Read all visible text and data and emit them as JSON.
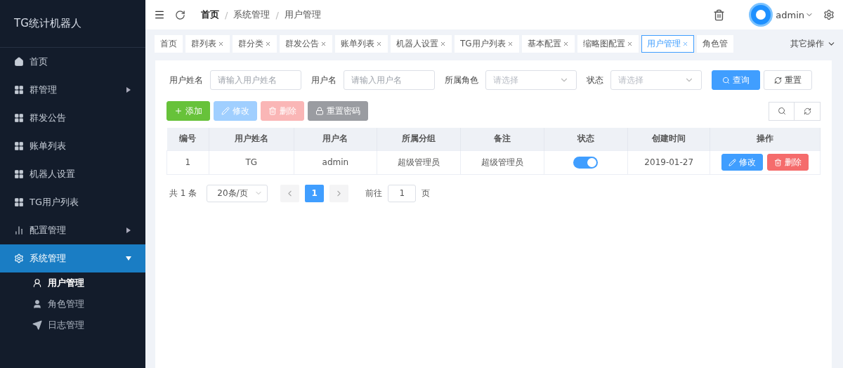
{
  "sidebar": {
    "title": "TG统计机器人",
    "items": [
      {
        "label": "首页",
        "selected": false
      },
      {
        "label": "群管理",
        "selected": false,
        "expanded": false
      },
      {
        "label": "群发公告",
        "selected": false
      },
      {
        "label": "账单列表",
        "selected": false
      },
      {
        "label": "机器人设置",
        "selected": false
      },
      {
        "label": "TG用户列表",
        "selected": false
      },
      {
        "label": "配置管理",
        "selected": false,
        "expanded": false
      },
      {
        "label": "系统管理",
        "selected": true,
        "expanded": true,
        "children": [
          {
            "label": "用户管理",
            "selected": true
          },
          {
            "label": "角色管理",
            "selected": false
          },
          {
            "label": "日志管理",
            "selected": false
          }
        ]
      }
    ]
  },
  "header": {
    "breadcrumb": [
      "首页",
      "系统管理",
      "用户管理"
    ],
    "breadcrumb_separator": "/",
    "user": "admin"
  },
  "tabs": [
    {
      "label": "首页",
      "selected": false,
      "closable": false
    },
    {
      "label": "群列表",
      "selected": false,
      "closable": true
    },
    {
      "label": "群分类",
      "selected": false,
      "closable": true
    },
    {
      "label": "群发公告",
      "selected": false,
      "closable": true
    },
    {
      "label": "账单列表",
      "selected": false,
      "closable": true
    },
    {
      "label": "机器人设置",
      "selected": false,
      "closable": true
    },
    {
      "label": "TG用户列表",
      "selected": false,
      "closable": true
    },
    {
      "label": "基本配置",
      "selected": false,
      "closable": true
    },
    {
      "label": "缩略图配置",
      "selected": false,
      "closable": true
    },
    {
      "label": "用户管理",
      "selected": true,
      "closable": true
    },
    {
      "label": "角色管",
      "selected": false,
      "closable": false
    }
  ],
  "tabs_menu": "其它操作",
  "filters": [
    {
      "kind": "input",
      "label": "用户姓名",
      "placeholder": "请输入用户姓名"
    },
    {
      "kind": "input",
      "label": "用户名",
      "placeholder": "请输入用户名"
    },
    {
      "kind": "select",
      "label": "所属角色",
      "placeholder": "请选择"
    },
    {
      "kind": "select",
      "label": "状态",
      "placeholder": "请选择"
    }
  ],
  "filter_buttons": [
    {
      "kind": "primary",
      "label": "查询"
    },
    {
      "kind": "plain",
      "label": "重置"
    }
  ],
  "actions": [
    {
      "kind": "add",
      "label": "添加",
      "disabled": false
    },
    {
      "kind": "edit",
      "label": "修改",
      "disabled": true
    },
    {
      "kind": "delete",
      "label": "删除",
      "disabled": true
    },
    {
      "kind": "lock",
      "label": "重置密码",
      "disabled": true
    }
  ],
  "table": {
    "columns": [
      "编号",
      "用户姓名",
      "用户名",
      "所属分组",
      "备注",
      "状态",
      "创建时间",
      "操作"
    ],
    "rows": [
      {
        "id": "1",
        "name": "TG",
        "username": "admin",
        "group": "超级管理员",
        "remark": "超级管理员",
        "on": true,
        "created": "2019-01-27",
        "buttons": [
          "修改",
          "删除"
        ]
      }
    ]
  },
  "pagination": {
    "total": "共 1 条",
    "page_size": "20条/页",
    "pages": [
      {
        "label": "1",
        "selected": true
      }
    ],
    "goto": "前往",
    "goto_value": "1",
    "goto_unit": "页"
  }
}
